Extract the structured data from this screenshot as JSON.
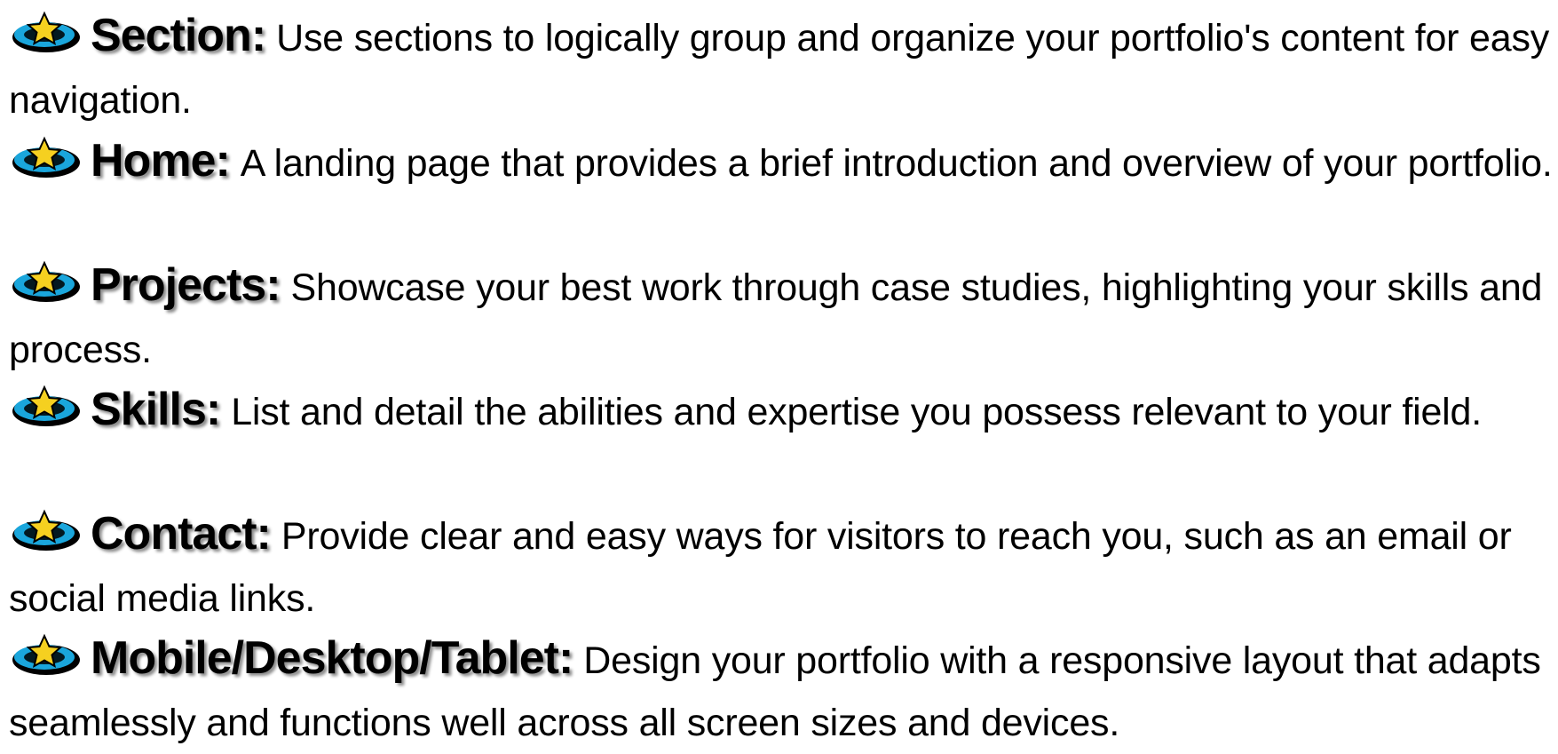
{
  "bullet_icon": {
    "name": "star-disc-icon",
    "colors": {
      "disc": "#1aa6dc",
      "star": "#f5d020",
      "outline": "#000000"
    }
  },
  "items": [
    {
      "term": "Section:",
      "description": "Use sections to logically group and organize your portfolio's content for easy navigation."
    },
    {
      "term": "Home:",
      "description": "A landing page that provides a brief introduction and overview of your portfolio."
    },
    {
      "term": "Projects:",
      "description": "Showcase your best work through case studies, highlighting your skills and process."
    },
    {
      "term": "Skills:",
      "description": "List and detail the abilities and expertise you possess relevant to your field."
    },
    {
      "term": "Contact:",
      "description": "Provide clear and easy ways for visitors to reach you, such as an email or social media links."
    },
    {
      "term": "Mobile/Desktop/Tablet:",
      "description": "Design your portfolio with a responsive layout that adapts seamlessly and functions well across all screen sizes and devices."
    }
  ]
}
